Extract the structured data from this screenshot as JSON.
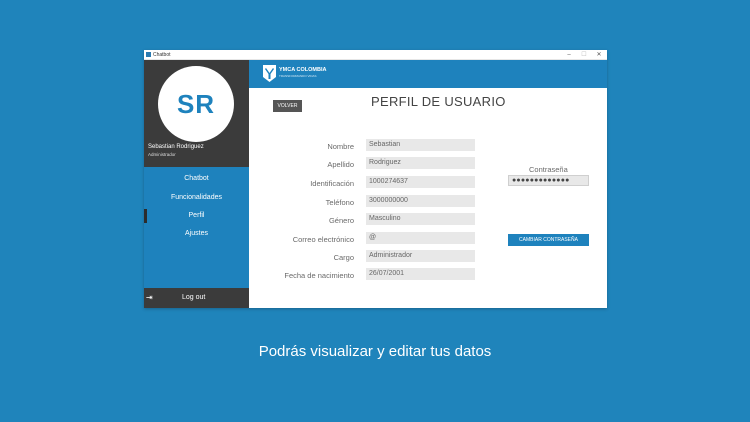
{
  "window": {
    "title": "Chatbot",
    "controls": [
      "–",
      "☐",
      "✕"
    ]
  },
  "sidebar": {
    "avatar_initials": "SR",
    "user_name": "Sebastian Rodriguez",
    "user_role": "Administrador",
    "items": [
      {
        "label": "Chatbot"
      },
      {
        "label": "Funcionalidades"
      },
      {
        "label": "Perfil"
      },
      {
        "label": "Ajustes"
      }
    ],
    "logout_icon": "⇥",
    "logout_label": "Log out"
  },
  "header": {
    "brand_name": "YMCA COLOMBIA",
    "brand_tagline": "TRANSFORMANDO VIDAS"
  },
  "profile": {
    "back_label": "VOLVER",
    "title": "PERFIL DE USUARIO",
    "fields": [
      {
        "label": "Nombre",
        "value": "Sebastian"
      },
      {
        "label": "Apellido",
        "value": "Rodriguez"
      },
      {
        "label": "Identificación",
        "value": "1000274637"
      },
      {
        "label": "Teléfono",
        "value": "3000000000"
      },
      {
        "label": "Género",
        "value": "Masculino"
      },
      {
        "label": "Correo electrónico",
        "value": "@"
      },
      {
        "label": "Cargo",
        "value": "Administrador"
      },
      {
        "label": "Fecha de nacimiento",
        "value": "26/07/2001"
      }
    ],
    "password_label": "Contraseña",
    "password_value": "●●●●●●●●●●●●●",
    "change_password_label": "CAMBIAR CONTRASEÑA"
  },
  "caption": "Podrás visualizar y editar tus datos",
  "colors": {
    "background": "#1f84bb",
    "accent": "#1e82bd",
    "dark": "#3b3b3b"
  }
}
